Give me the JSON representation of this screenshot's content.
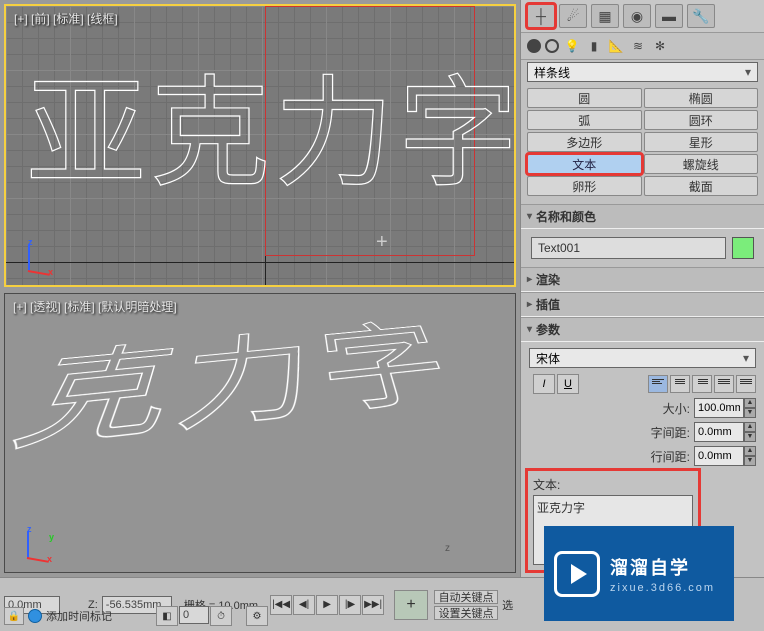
{
  "viewports": {
    "top": {
      "label": "[+] [前] [标准] [线框]",
      "display_text": "亚克力字"
    },
    "bottom": {
      "label": "[+] [透视] [标准] [默认明暗处理]",
      "display_text": "克力字"
    }
  },
  "panel": {
    "category_dropdown": "样条线",
    "shapes": {
      "circle": "圆",
      "ellipse": "椭圆",
      "arc": "弧",
      "donut": "圆环",
      "ngon": "多边形",
      "star": "星形",
      "text": "文本",
      "helix": "螺旋线",
      "egg": "卵形",
      "section": "截面"
    },
    "sections": {
      "name_color": "名称和颜色",
      "render": "渲染",
      "interp": "插值",
      "params": "参数"
    },
    "name_value": "Text001",
    "color_value": "#7bed7b",
    "params": {
      "font_dropdown": "宋体",
      "size_label": "大小:",
      "size_value": "100.0mm",
      "kerning_label": "字间距:",
      "kerning_value": "0.0mm",
      "leading_label": "行间距:",
      "leading_value": "0.0mm",
      "text_label": "文本:",
      "text_value": "亚克力字"
    }
  },
  "bottom": {
    "x_value": "0.0mm",
    "z_label": "Z:",
    "z_value": "-56.535mm",
    "grid_label": "栅格 = 10.0mm",
    "auto_key": "自动关键点",
    "selected": "选",
    "add_time_tag": "添加时间标记",
    "set_key": "设置关键点"
  },
  "watermark": {
    "title": "溜溜自学",
    "sub": "zixue.3d66.com"
  }
}
